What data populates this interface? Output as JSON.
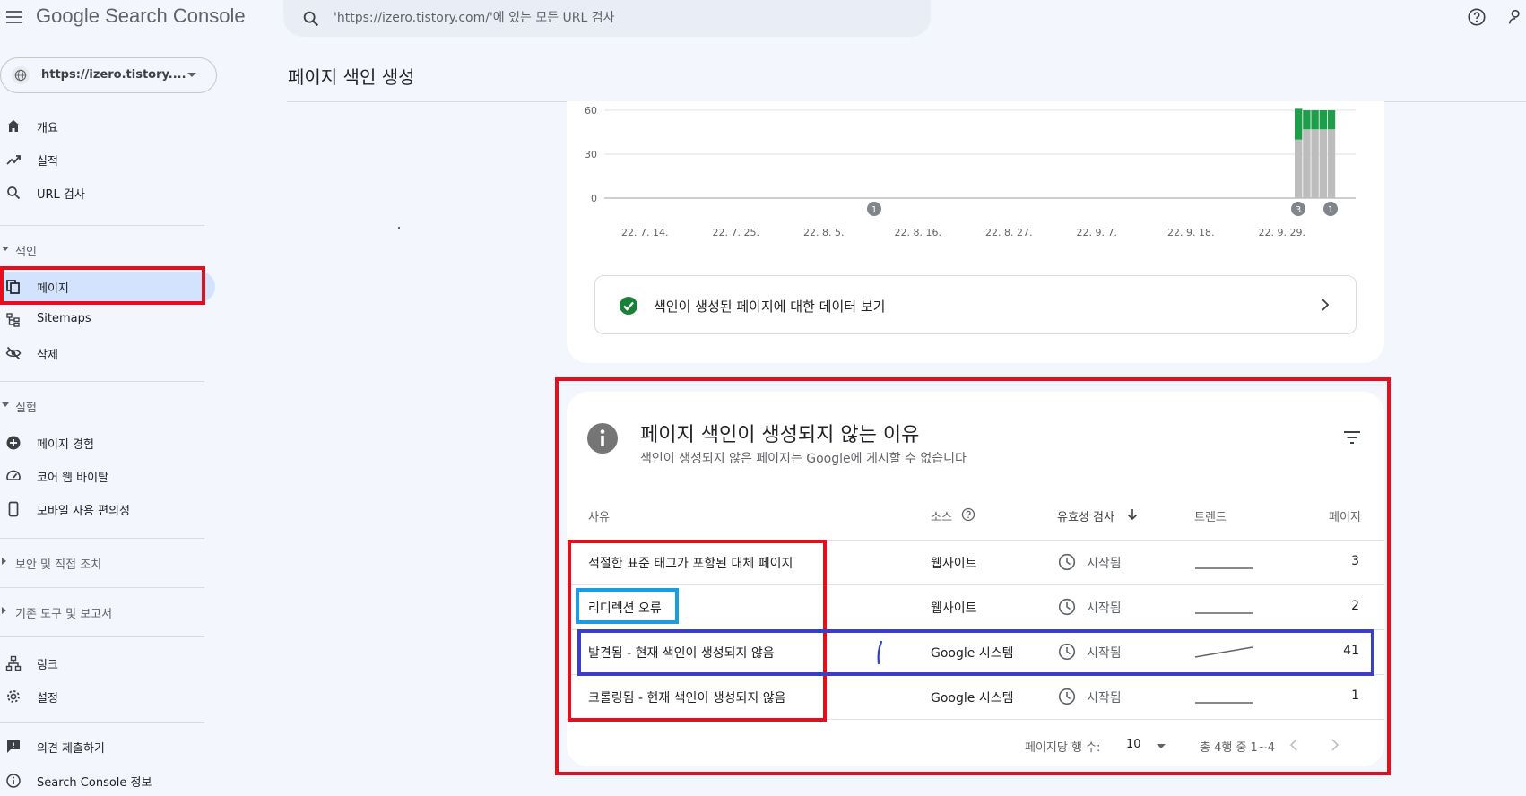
{
  "app": {
    "logo_google": "Google",
    "logo_product": "Search Console"
  },
  "search": {
    "placeholder": "'https://izero.tistory.com/'에 있는 모든 URL 검사"
  },
  "property": {
    "url": "https://izero.tistory...."
  },
  "sidebar": {
    "items_top": [
      {
        "label": "개요",
        "icon": "home-icon"
      },
      {
        "label": "실적",
        "icon": "trending-up-icon"
      },
      {
        "label": "URL 검사",
        "icon": "search-icon"
      }
    ],
    "section_index": "색인",
    "items_index": [
      {
        "label": "페이지",
        "icon": "pages-icon",
        "active": true
      },
      {
        "label": "Sitemaps",
        "icon": "sitemap-icon"
      },
      {
        "label": "삭제",
        "icon": "eye-off-icon"
      }
    ],
    "section_experience": "실험",
    "items_experience": [
      {
        "label": "페이지 경험",
        "icon": "plus-circle-icon"
      },
      {
        "label": "코어 웹 바이탈",
        "icon": "gauge-icon"
      },
      {
        "label": "모바일 사용 편의성",
        "icon": "phone-icon"
      }
    ],
    "section_security": "보안 및 직접 조치",
    "section_legacy": "기존 도구 및 보고서",
    "items_bottom": [
      {
        "label": "링크",
        "icon": "link-network-icon"
      },
      {
        "label": "설정",
        "icon": "gear-icon"
      }
    ],
    "items_footer": [
      {
        "label": "의견 제출하기",
        "icon": "feedback-icon"
      },
      {
        "label": "Search Console 정보",
        "icon": "info-icon"
      }
    ]
  },
  "page": {
    "title": "페이지 색인 생성"
  },
  "chart_data": {
    "type": "bar",
    "y_ticks": [
      "60",
      "30",
      "0"
    ],
    "ylim": [
      0,
      60
    ],
    "x_tick_labels": [
      "22. 7. 14.",
      "22. 7. 25.",
      "22. 8. 5.",
      "22. 8. 16.",
      "22. 8. 27.",
      "22. 9. 7.",
      "22. 9. 18.",
      "22. 9. 29."
    ],
    "series": [
      {
        "name": "",
        "color": "#bdbdbd",
        "values": [
          40,
          47,
          47,
          47,
          47
        ]
      },
      {
        "name": "",
        "color": "#1e9e4a",
        "values": [
          21,
          13,
          13,
          13,
          13
        ]
      }
    ],
    "annotations": [
      "1",
      "3",
      "1"
    ],
    "grid": true
  },
  "indexed_link": {
    "label": "색인이 생성된 페이지에 대한 데이터 보기"
  },
  "reasons": {
    "title": "페이지 색인이 생성되지 않는 이유",
    "subtitle": "색인이 생성되지 않은 페이지는 Google에 게시할 수 없습니다",
    "headers": {
      "reason": "사유",
      "source": "소스",
      "validation": "유효성 검사",
      "trend": "트렌드",
      "pages": "페이지"
    },
    "rows": [
      {
        "reason": "적절한 표준 태그가 포함된 대체 페이지",
        "source": "웹사이트",
        "status": "시작됨",
        "pages": "3"
      },
      {
        "reason": "리디렉션 오류",
        "source": "웹사이트",
        "status": "시작됨",
        "pages": "2"
      },
      {
        "reason": "발견됨 - 현재 색인이 생성되지 않음",
        "source": "Google 시스템",
        "status": "시작됨",
        "pages": "41"
      },
      {
        "reason": "크롤링됨 - 현재 색인이 생성되지 않음",
        "source": "Google 시스템",
        "status": "시작됨",
        "pages": "1"
      }
    ],
    "pager": {
      "rows_per_page_label": "페이지당 행 수:",
      "rows_per_page_value": "10",
      "range_label": "총 4행 중 1~4"
    }
  }
}
